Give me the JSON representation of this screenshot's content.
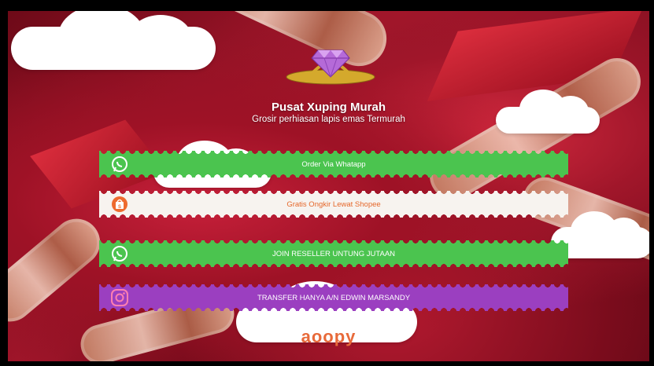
{
  "header": {
    "title": "Pusat Xuping Murah",
    "subtitle": "Grosir perhiasan lapis emas Termurah"
  },
  "buttons": [
    {
      "label": "Order Via Whatapp",
      "icon": "whatsapp-icon",
      "color": "#4bc44f"
    },
    {
      "label": "Gratis Ongkir Lewat Shopee",
      "icon": "shopee-icon",
      "color": "#f7f3ef"
    },
    {
      "label": "JOIN RESELLER UNTUNG JUTAAN",
      "icon": "whatsapp-icon",
      "color": "#4bc44f"
    },
    {
      "label": "TRANSFER HANYA A/N EDWIN MARSANDY",
      "icon": "instagram-icon",
      "color": "#9b3fc0"
    }
  ],
  "footer": {
    "brand": "aoopy"
  },
  "colors": {
    "background": "#a3162b",
    "whatsapp": "#4bc44f",
    "shopee_text": "#e5672a",
    "purple": "#9b3fc0"
  }
}
